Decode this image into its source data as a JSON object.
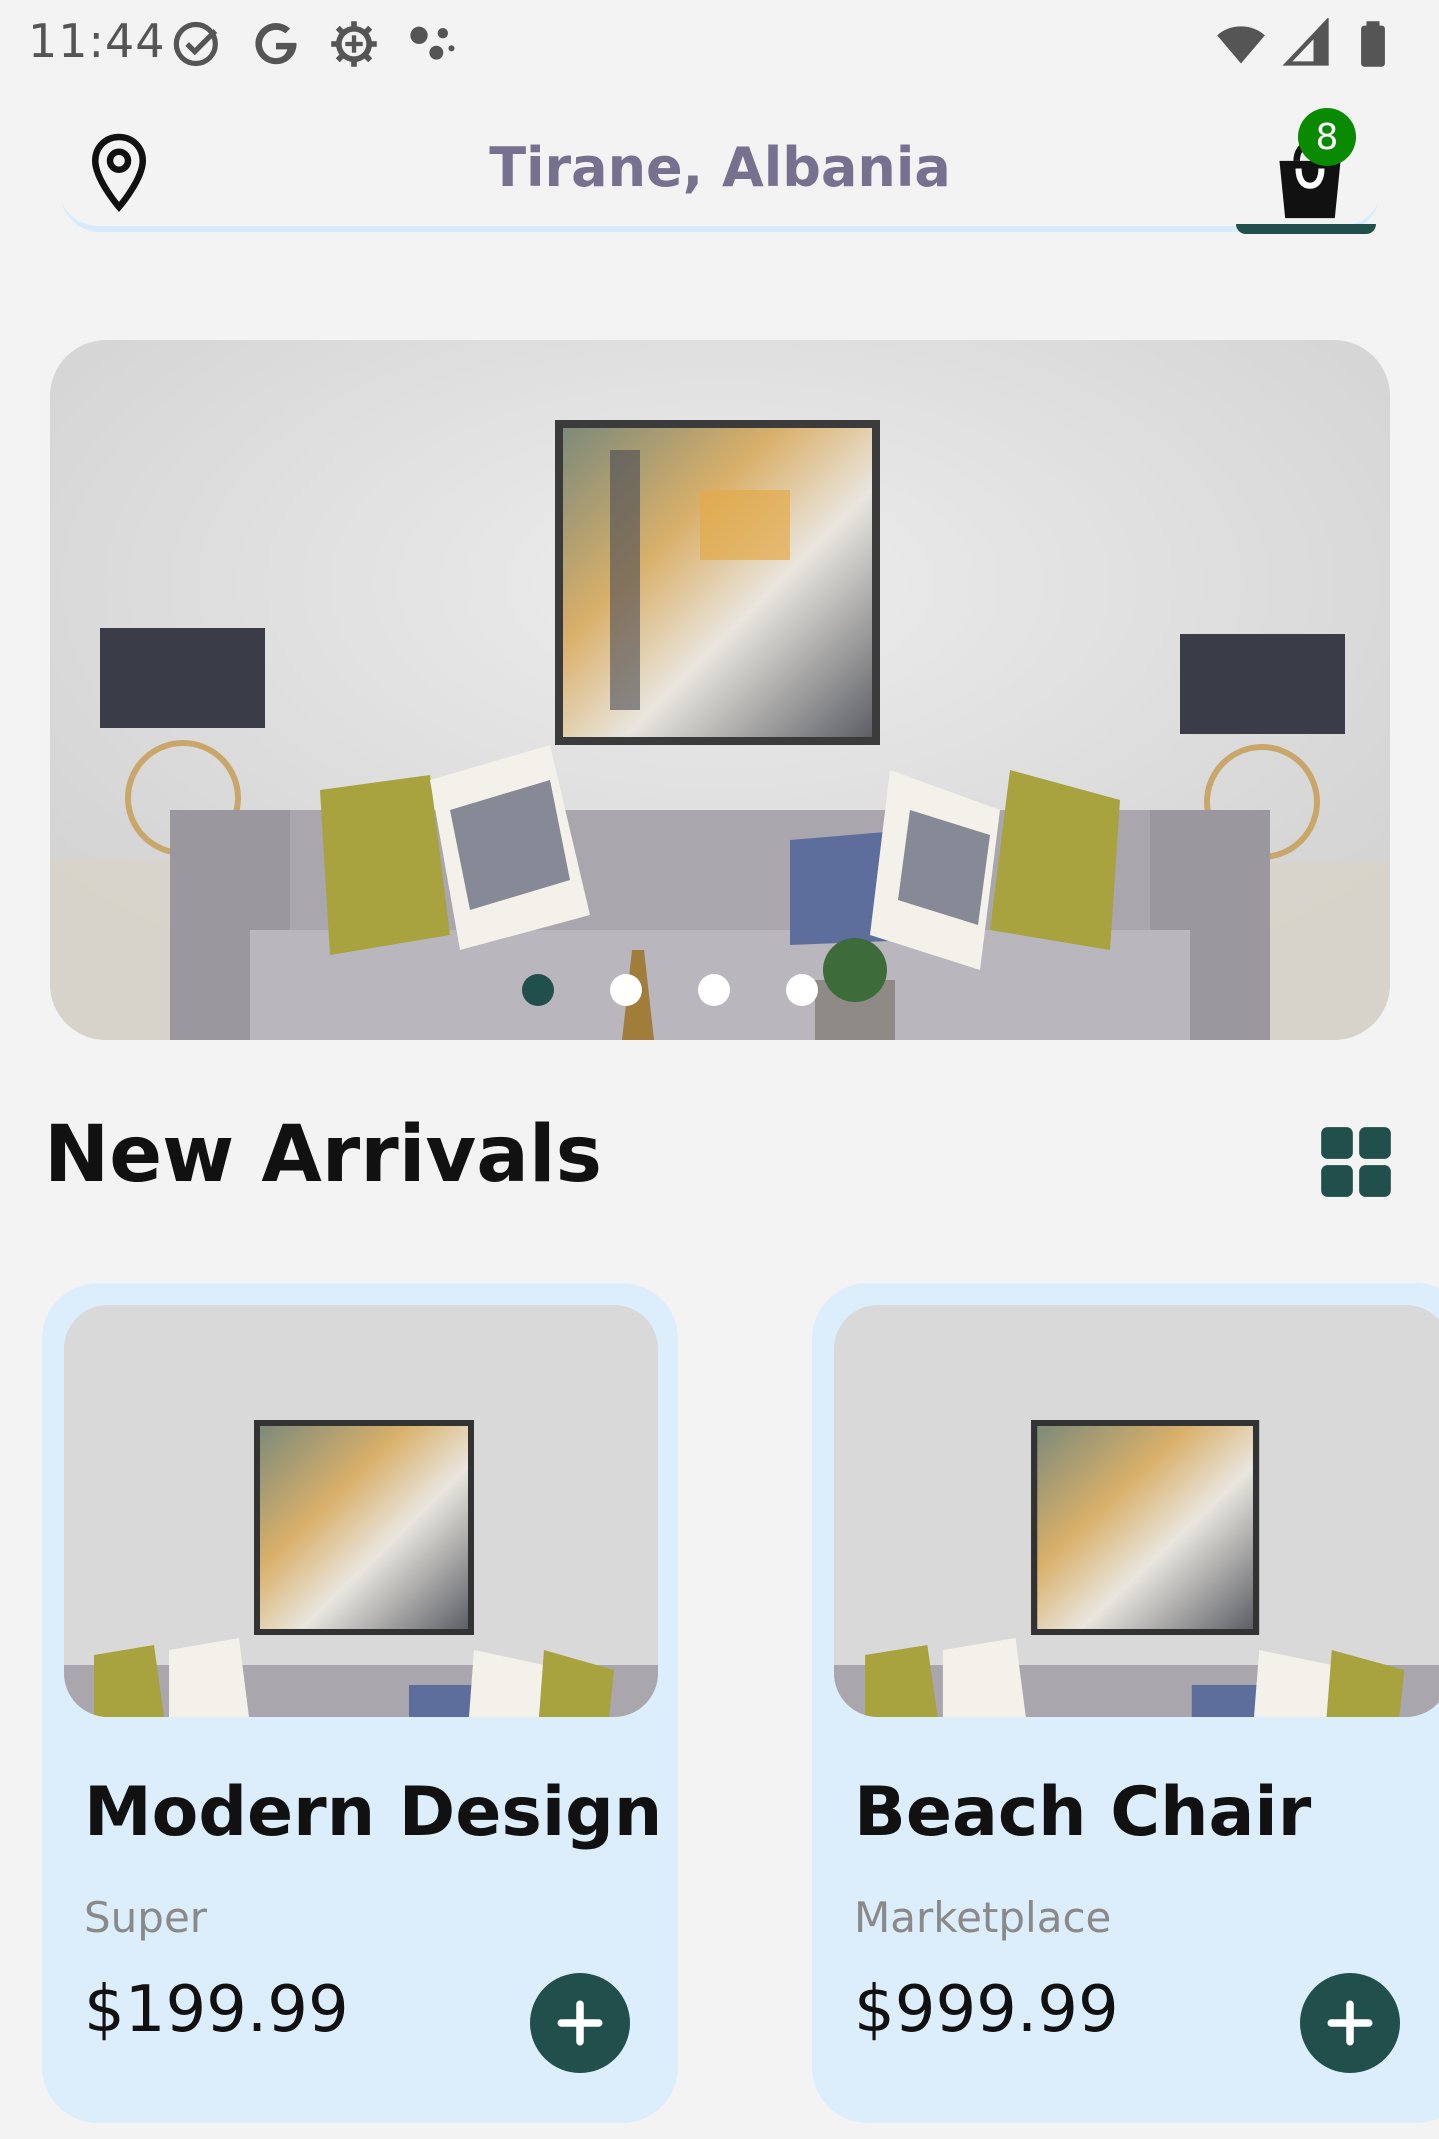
{
  "status_bar": {
    "time": "11:44",
    "icons_left": [
      "check-circle-icon",
      "google-icon",
      "settings-gear-icon",
      "assistant-dots-icon"
    ],
    "icons_right": [
      "wifi-icon",
      "cellular-signal-icon",
      "battery-icon"
    ]
  },
  "header": {
    "location": "Tirane, Albania",
    "cart_count": "8",
    "location_icon": "map-pin-icon",
    "cart_icon": "shopping-bag-icon"
  },
  "banner": {
    "slide_count": 4,
    "active_slide": 1
  },
  "new_arrivals": {
    "title": "New Arrivals",
    "view_icon": "grid-view-icon",
    "products": [
      {
        "title": "Modern Design",
        "subtitle": "Super",
        "price": "$199.99"
      },
      {
        "title": "Beach Chair",
        "subtitle": "Marketplace",
        "price": "$999.99"
      }
    ]
  },
  "colors": {
    "accent": "#214f4b",
    "card_bg": "#dcedfb",
    "badge": "#0a8a00",
    "location_text": "#77708f"
  }
}
